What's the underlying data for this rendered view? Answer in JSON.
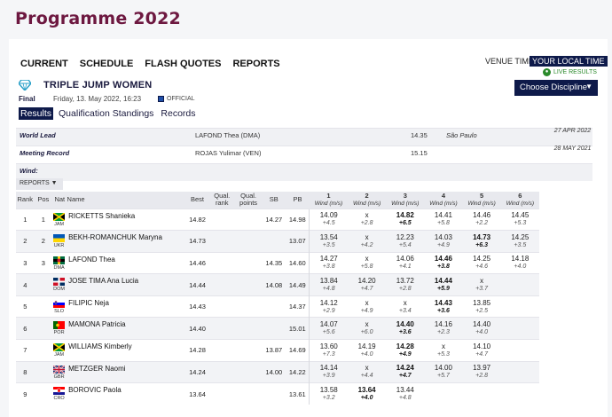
{
  "page_title": "Programme 2022",
  "nav": [
    "CURRENT",
    "SCHEDULE",
    "FLASH QUOTES",
    "REPORTS"
  ],
  "venue_time": "VENUE TIME",
  "local_time": "YOUR LOCAL TIME",
  "live_results": "LIVE RESULTS",
  "choose_discipline": "Choose Discipline",
  "event": {
    "title": "TRIPLE JUMP WOMEN",
    "round": "Final",
    "date": "Friday, 13. May 2022, 16:23",
    "official": "OFFICIAL"
  },
  "subtabs": [
    "Results",
    "Qualification Standings",
    "Records"
  ],
  "records": [
    {
      "label": "World Lead",
      "name": "LAFOND Thea (DMA)",
      "mark": "14.35",
      "place": "São Paulo",
      "date": "27 APR 2022"
    },
    {
      "label": "Meeting Record",
      "name": "ROJAS Yulimar (VEN)",
      "mark": "15.15",
      "place": "",
      "date": "28 MAY 2021"
    },
    {
      "label": "Wind:",
      "name": "",
      "mark": "",
      "place": "",
      "date": ""
    }
  ],
  "reports_label": "REPORTS",
  "headers": {
    "rank": "Rank",
    "pos": "Pos",
    "nat": "Nat",
    "name": "Name",
    "best": "Best",
    "qual_rank": "Qual. rank",
    "qual_points": "Qual. points",
    "sb": "SB",
    "pb": "PB",
    "attempts": [
      "1",
      "2",
      "3",
      "4",
      "5",
      "6"
    ],
    "wind": "Wind (m/s)"
  },
  "colors": {
    "brand": "#6d1840",
    "navy": "#0e1a4a",
    "live": "#2a8a2a"
  },
  "rows": [
    {
      "rank": "1",
      "pos": "1",
      "nat": "JAM",
      "name": "RICKETTS Shanieka",
      "best": "14.82",
      "sb": "14.27",
      "pb": "14.98",
      "attempts": [
        [
          "14.09",
          "+4.5"
        ],
        [
          "x",
          "+2.8"
        ],
        [
          "14.82",
          "+6.5"
        ],
        [
          "14.41",
          "+5.8"
        ],
        [
          "14.46",
          "+2.2"
        ],
        [
          "14.45",
          "+5.3"
        ]
      ],
      "bold": [
        2
      ]
    },
    {
      "rank": "2",
      "pos": "2",
      "nat": "UKR",
      "name": "BEKH-ROMANCHUK Maryna",
      "best": "14.73",
      "sb": "",
      "pb": "13.07",
      "attempts": [
        [
          "13.54",
          "+3.5"
        ],
        [
          "x",
          "+4.2"
        ],
        [
          "12.23",
          "+5.4"
        ],
        [
          "14.03",
          "+4.9"
        ],
        [
          "14.73",
          "+6.3"
        ],
        [
          "14.25",
          "+3.5"
        ]
      ],
      "bold": [
        4
      ]
    },
    {
      "rank": "3",
      "pos": "3",
      "nat": "DMA",
      "name": "LAFOND Thea",
      "best": "14.46",
      "sb": "14.35",
      "pb": "14.60",
      "attempts": [
        [
          "14.27",
          "+3.8"
        ],
        [
          "x",
          "+5.8"
        ],
        [
          "14.06",
          "+4.1"
        ],
        [
          "14.46",
          "+3.8"
        ],
        [
          "14.25",
          "+4.6"
        ],
        [
          "14.18",
          "+4.0"
        ]
      ],
      "bold": [
        3
      ]
    },
    {
      "rank": "4",
      "pos": "",
      "nat": "DOM",
      "name": "JOSE TIMA Ana Lucia",
      "best": "14.44",
      "sb": "14.08",
      "pb": "14.49",
      "attempts": [
        [
          "13.84",
          "+4.8"
        ],
        [
          "14.20",
          "+4.7"
        ],
        [
          "13.72",
          "+2.8"
        ],
        [
          "14.44",
          "+5.9"
        ],
        [
          "x",
          "+3.7"
        ],
        [
          "",
          ""
        ]
      ],
      "bold": [
        3
      ]
    },
    {
      "rank": "5",
      "pos": "",
      "nat": "SLO",
      "name": "FILIPIC Neja",
      "best": "14.43",
      "sb": "",
      "pb": "14.37",
      "attempts": [
        [
          "14.12",
          "+2.9"
        ],
        [
          "x",
          "+4.9"
        ],
        [
          "x",
          "+3.4"
        ],
        [
          "14.43",
          "+3.6"
        ],
        [
          "13.85",
          "+2.5"
        ],
        [
          "",
          ""
        ]
      ],
      "bold": [
        3
      ]
    },
    {
      "rank": "6",
      "pos": "",
      "nat": "POR",
      "name": "MAMONA Patricia",
      "best": "14.40",
      "sb": "",
      "pb": "15.01",
      "attempts": [
        [
          "14.07",
          "+5.6"
        ],
        [
          "x",
          "+6.0"
        ],
        [
          "14.40",
          "+3.6"
        ],
        [
          "14.16",
          "+2.3"
        ],
        [
          "14.40",
          "+4.0"
        ],
        [
          "",
          ""
        ]
      ],
      "bold": [
        2
      ]
    },
    {
      "rank": "7",
      "pos": "",
      "nat": "JAM",
      "name": "WILLIAMS Kimberly",
      "best": "14.28",
      "sb": "13.87",
      "pb": "14.69",
      "attempts": [
        [
          "13.60",
          "+7.3"
        ],
        [
          "14.19",
          "+4.0"
        ],
        [
          "14.28",
          "+4.9"
        ],
        [
          "x",
          "+5.3"
        ],
        [
          "14.10",
          "+4.7"
        ],
        [
          "",
          ""
        ]
      ],
      "bold": [
        2
      ]
    },
    {
      "rank": "8",
      "pos": "",
      "nat": "GBR",
      "name": "METZGER Naomi",
      "best": "14.24",
      "sb": "14.00",
      "pb": "14.22",
      "attempts": [
        [
          "14.14",
          "+3.9"
        ],
        [
          "x",
          "+4.4"
        ],
        [
          "14.24",
          "+4.7"
        ],
        [
          "14.00",
          "+5.7"
        ],
        [
          "13.97",
          "+2.8"
        ],
        [
          "",
          ""
        ]
      ],
      "bold": [
        2
      ]
    },
    {
      "rank": "9",
      "pos": "",
      "nat": "CRO",
      "name": "BOROVIC Paola",
      "best": "13.64",
      "sb": "",
      "pb": "13.61",
      "attempts": [
        [
          "13.58",
          "+3.2"
        ],
        [
          "13.64",
          "+4.0"
        ],
        [
          "13.44",
          "+4.8"
        ],
        [
          "",
          ""
        ],
        [
          "",
          ""
        ],
        [
          "",
          ""
        ]
      ],
      "bold": [
        1
      ]
    }
  ]
}
